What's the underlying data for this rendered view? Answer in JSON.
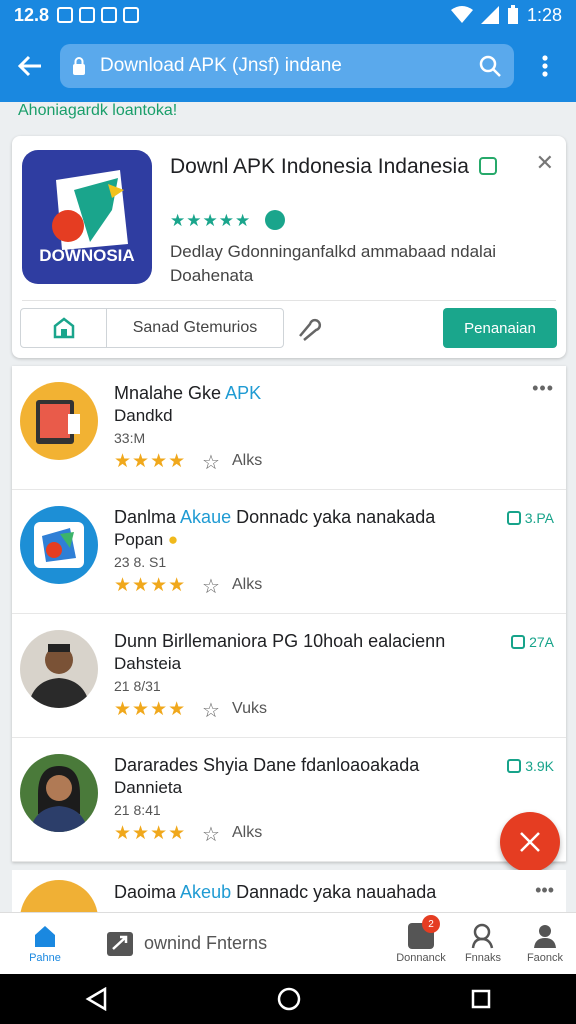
{
  "status": {
    "time_left": "12.8",
    "time_right": "1:28"
  },
  "search": {
    "query": "Download APK (Jnsf) indane"
  },
  "breadcrumb": "Ahoniagardk loantoka!",
  "hero": {
    "title": "Downl APK Indonesia Indanesia",
    "stars": "★★★★★",
    "description": "Dedlay Gdonninganfalkd ammabaad ndalai Doahenata",
    "logo_text": "DOWNOSIA",
    "secondary_label": "Sanad Gtemurios",
    "primary_label": "Penanaian"
  },
  "list": [
    {
      "name_pre": "Mnalahe Gke ",
      "name_hl": "APK",
      "name_post": "",
      "dev": "Dandkd",
      "size": "33:M",
      "stars": "★★★★",
      "rating_label": "Alks",
      "download": "",
      "avatar_color": "#f2b233"
    },
    {
      "name_pre": "Danlma ",
      "name_hl": "Akaue",
      "name_post": " Donnadc yaka nanakada",
      "dev": "Popan",
      "size": "23 8. S1",
      "stars": "★★★★",
      "rating_label": "Alks",
      "download": "3.PA",
      "avatar_color": "#1d8fd6"
    },
    {
      "name_pre": "Dunn Birllemaniora PG 10hoah ealacienn",
      "name_hl": "",
      "name_post": "",
      "dev": "Dahsteia",
      "size": "21 8/31",
      "stars": "★★★★",
      "rating_label": "Vuks",
      "download": "27A",
      "avatar_color": "#c9c4bc"
    },
    {
      "name_pre": "Dararades Shyia Dane fdanloaoakada",
      "name_hl": "",
      "name_post": "",
      "dev": "Dannieta",
      "size": "21 8:41",
      "stars": "★★★★",
      "rating_label": "Alks",
      "download": "3.9K",
      "avatar_color": "#4a7a3a"
    }
  ],
  "partial": {
    "name_pre": "Daoima ",
    "name_hl": "Akeub",
    "name_post": " Dannadc yaka nauahada"
  },
  "bottom_nav": {
    "home": "Pahne",
    "middle": "ownind Fnterns",
    "n2": "Donnanck",
    "n3": "Fnnaks",
    "n4": "Faonck",
    "notif_count": "2"
  },
  "colors": {
    "accent": "#1a88e0",
    "primary_button": "#1aa68c",
    "fab": "#e53d22",
    "star": "#f0a81c"
  }
}
